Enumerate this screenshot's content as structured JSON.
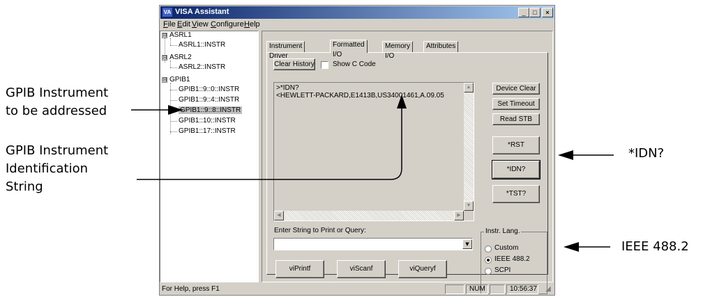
{
  "window": {
    "app_icon": "VA",
    "title": "VISA Assistant",
    "controls": {
      "minimize": "_",
      "maximize": "□",
      "close": "×"
    }
  },
  "menu": [
    "File",
    "Edit",
    "View",
    "Configure",
    "Help"
  ],
  "tree": {
    "groups": [
      {
        "label": "ASRL1",
        "children": [
          "ASRL1::INSTR"
        ]
      },
      {
        "label": "ASRL2",
        "children": [
          "ASRL2::INSTR"
        ]
      },
      {
        "label": "GPIB1",
        "children": [
          "GPIB1::9::0::INSTR",
          "GPIB1::9::4::INSTR",
          "GPIB1::9::8::INSTR",
          "GPIB1::10::INSTR",
          "GPIB1::17::INSTR"
        ]
      }
    ],
    "selected": "GPIB1::9::8::INSTR",
    "expander": "⊟"
  },
  "tabs": [
    "Instrument Driver",
    "Formatted I/O",
    "Memory I/O",
    "Attributes"
  ],
  "active_tab": "Formatted I/O",
  "formatted_io": {
    "clear_history": "Clear History",
    "show_c_code": "Show C Code",
    "output_lines": [
      ">*IDN?",
      "<HEWLETT-PACKARD,E1413B,US34001461,A.09.05"
    ],
    "side_buttons": [
      "Device Clear",
      "Set Timeout",
      "Read STB"
    ],
    "cmd_buttons": [
      "*RST",
      "*IDN?",
      "*TST?"
    ],
    "input_label": "Enter String to Print or Query:",
    "input_value": "",
    "bottom_buttons": [
      "viPrintf",
      "viScanf",
      "viQueryf"
    ],
    "lang_group": {
      "title": "Instr. Lang.",
      "options": [
        "Custom",
        "IEEE 488.2",
        "SCPI"
      ],
      "selected": "IEEE 488.2"
    }
  },
  "statusbar": {
    "help": "For Help, press F1",
    "num": "NUM",
    "time": "10:56:37"
  },
  "annotations": {
    "gpib_address": [
      "GPIB Instrument",
      "to be addressed"
    ],
    "gpib_id": [
      "GPIB Instrument",
      "Identification",
      "String"
    ],
    "idn": "*IDN?",
    "ieee": "IEEE 488.2"
  }
}
